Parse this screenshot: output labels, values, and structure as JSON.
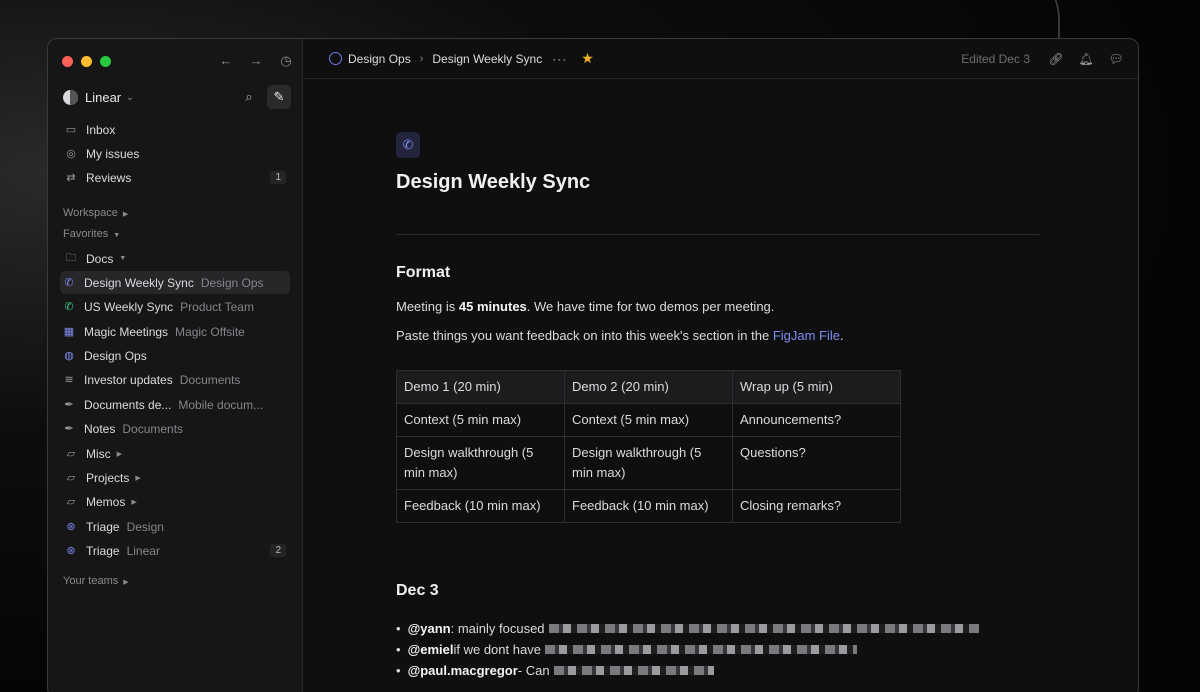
{
  "colors": {
    "accent": "#7d8cf0",
    "star": "#f0b429",
    "close": "#ff5f57",
    "minimize": "#febc2e",
    "zoom": "#28c840"
  },
  "sidebar": {
    "workspace": "Linear",
    "items": [
      {
        "label": "Inbox",
        "icon": "inbox-icon"
      },
      {
        "label": "My issues",
        "icon": "target-icon"
      },
      {
        "label": "Reviews",
        "icon": "review-icon",
        "badge": "1"
      }
    ],
    "workspace_label": "Workspace",
    "favorites_label": "Favorites",
    "docs_label": "Docs",
    "docs": [
      {
        "label": "Design Weekly Sync",
        "sub": "Design Ops",
        "icon": "phone-icon"
      },
      {
        "label": "US Weekly Sync",
        "sub": "Product Team",
        "icon": "phone-icon"
      },
      {
        "label": "Magic Meetings",
        "sub": "Magic Offsite",
        "icon": "calendar-icon"
      },
      {
        "label": "Design Ops",
        "sub": "",
        "icon": "globe-icon"
      },
      {
        "label": "Investor updates",
        "sub": "Documents",
        "icon": "layers-icon"
      },
      {
        "label": "Documents de...",
        "sub": "Mobile docum...",
        "icon": "feather-icon"
      },
      {
        "label": "Notes",
        "sub": "Documents",
        "icon": "feather-icon"
      }
    ],
    "folders": [
      {
        "label": "Misc",
        "icon": "folder-icon"
      },
      {
        "label": "Projects",
        "icon": "folder-icon"
      },
      {
        "label": "Memos",
        "icon": "folder-icon"
      }
    ],
    "triage": [
      {
        "label": "Triage",
        "sub": "Design",
        "badge": ""
      },
      {
        "label": "Triage",
        "sub": "Linear",
        "badge": "2"
      }
    ],
    "your_teams_label": "Your teams"
  },
  "topbar": {
    "crumb_team": "Design Ops",
    "crumb_doc": "Design Weekly Sync",
    "edited": "Edited Dec 3"
  },
  "doc": {
    "title": "Design Weekly Sync",
    "format_heading": "Format",
    "p1_pre": "Meeting is ",
    "p1_bold": "45 minutes",
    "p1_post": ". We have time for two demos per meeting.",
    "p2_pre": "Paste things you want feedback on into this week's section in the ",
    "p2_link": "FigJam File",
    "p2_post": ".",
    "table": [
      [
        "Demo 1 (20 min)",
        "Demo 2 (20 min)",
        "Wrap up (5 min)"
      ],
      [
        "Context (5 min max)",
        "Context (5 min max)",
        "Announcements?"
      ],
      [
        "Design walkthrough (5 min max)",
        "Design walkthrough (5 min max)",
        "Questions?"
      ],
      [
        "Feedback (10 min max)",
        "Feedback (10 min max)",
        "Closing remarks?"
      ]
    ],
    "dec_heading": "Dec 3",
    "notes": [
      {
        "mention": "@yann",
        "text": ": mainly focused"
      },
      {
        "mention": "@emiel",
        "text": " if we dont have"
      },
      {
        "mention": "@paul.macgregor",
        "text": " - Can"
      }
    ]
  }
}
